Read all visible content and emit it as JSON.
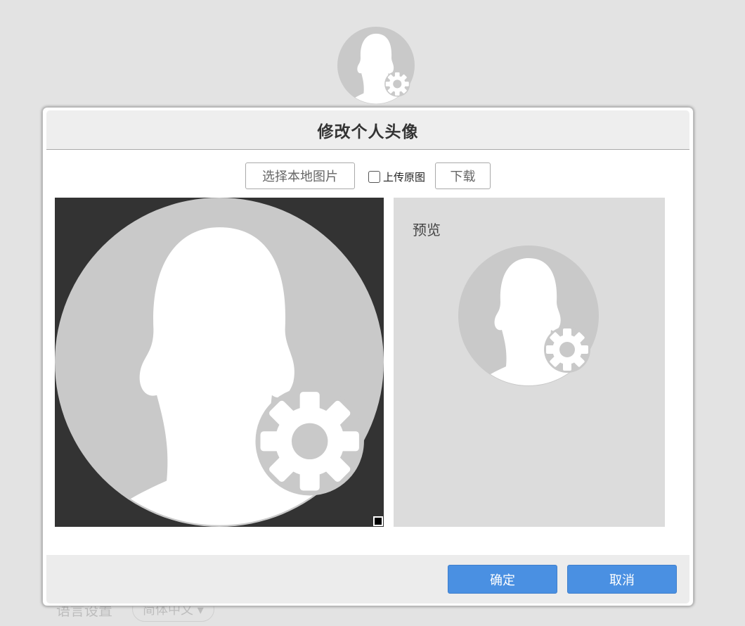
{
  "background": {
    "avatar_icon": "user-settings-avatar",
    "language_label": "语言设置",
    "language_value": "简体中文"
  },
  "dialog": {
    "title": "修改个人头像",
    "toolbar": {
      "select_local_label": "选择本地图片",
      "upload_original_label": "上传原图",
      "upload_original_checked": false,
      "download_label": "下载"
    },
    "crop": {
      "image_icon": "user-settings-avatar"
    },
    "preview": {
      "label": "预览",
      "image_icon": "user-settings-avatar"
    },
    "footer": {
      "ok_label": "确定",
      "cancel_label": "取消"
    }
  },
  "colors": {
    "primary": "#4a90e2",
    "avatar_bg": "#c9c9c9",
    "crop_bg": "#333333",
    "preview_bg": "#dcdcdc"
  }
}
